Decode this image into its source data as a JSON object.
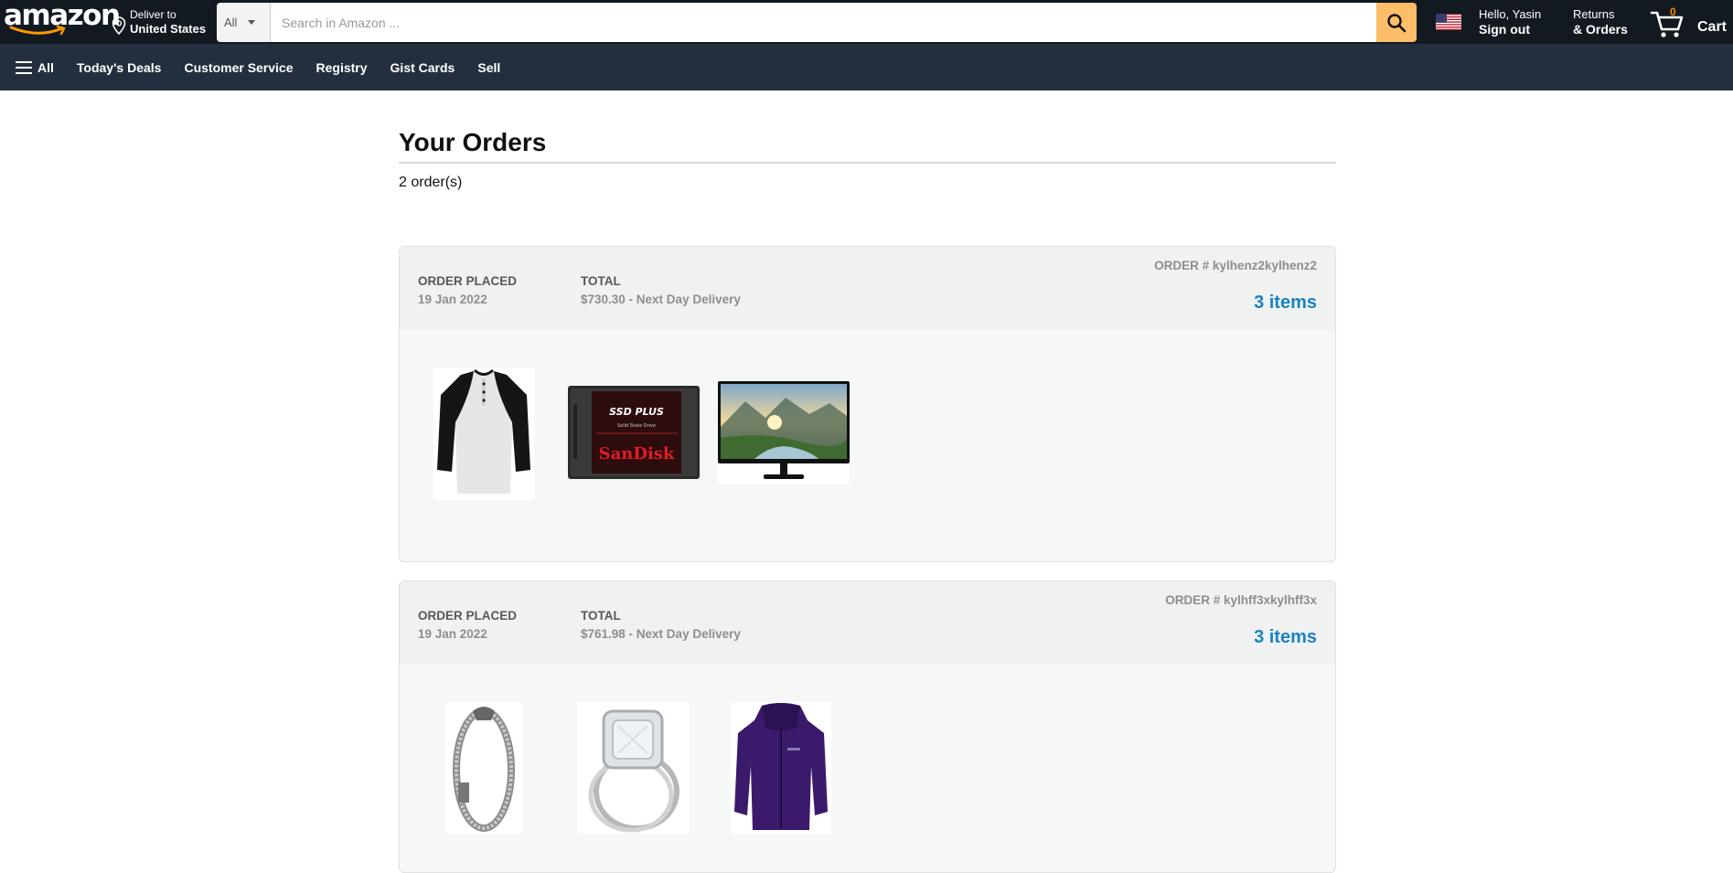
{
  "header": {
    "logo": "amazon",
    "deliver_line1": "Deliver to",
    "deliver_line2": "United States",
    "search_category": "All",
    "search_placeholder": "Search in Amazon ...",
    "account_line1": "Hello, Yasin",
    "account_line2": "Sign out",
    "returns_line1": "Returns",
    "returns_line2": "& Orders",
    "cart_count": "0",
    "cart_label": "Cart"
  },
  "subnav": {
    "all": "All",
    "items": [
      "Today's Deals",
      "Customer Service",
      "Registry",
      "Gist Cards",
      "Sell"
    ]
  },
  "page": {
    "title": "Your Orders",
    "count": "2 order(s)"
  },
  "orders": [
    {
      "placed_label": "ORDER PLACED",
      "placed_date": "19 Jan 2022",
      "total_label": "TOTAL",
      "total_value": "$730.30 - Next Day Delivery",
      "order_number": "ORDER # kylhenz2kylhenz2",
      "items_link": "3 items",
      "products": [
        "henley-shirt",
        "sandisk-ssd",
        "monitor"
      ],
      "ssd_text_top": "SSD PLUS",
      "ssd_text_sub": "Solid State Drive",
      "ssd_brand": "SanDisk"
    },
    {
      "placed_label": "ORDER PLACED",
      "placed_date": "19 Jan 2022",
      "total_label": "TOTAL",
      "total_value": "$761.98 - Next Day Delivery",
      "order_number": "ORDER # kylhff3xkylhff3x",
      "items_link": "3 items",
      "products": [
        "silver-bracelet",
        "diamond-ring",
        "purple-jacket"
      ]
    }
  ],
  "colors": {
    "header_bg": "#131921",
    "subnav_bg": "#232f3e",
    "search_button": "#febd69",
    "link_blue": "#1a82c2",
    "cart_count": "#f08804"
  }
}
